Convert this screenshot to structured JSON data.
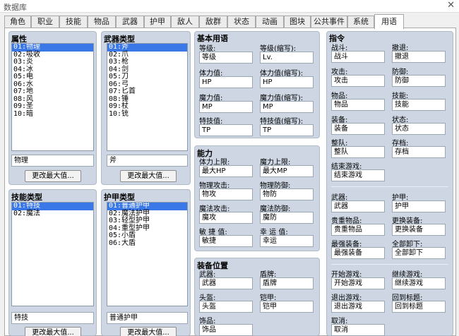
{
  "window": {
    "title": "数据库",
    "close": "✕"
  },
  "tabs": [
    "角色",
    "职业",
    "技能",
    "物品",
    "武器",
    "护甲",
    "敌人",
    "敌群",
    "状态",
    "动画",
    "图块",
    "公共事件",
    "系统",
    "用语"
  ],
  "attributes": {
    "title": "属性",
    "items": [
      "01:物理",
      "02:吸收",
      "03:炎",
      "04:冰",
      "05:电",
      "06:水",
      "07:地",
      "08:风",
      "09:圣",
      "10:暗"
    ],
    "value": "物理",
    "button": "更改最大值..."
  },
  "weapon_types": {
    "title": "武器类型",
    "items": [
      "01:斧",
      "02:爪",
      "03:枪",
      "04:剑",
      "05:刀",
      "06:弓",
      "07:匕首",
      "08:锤",
      "09:杖",
      "10:铳"
    ],
    "value": "斧",
    "button": "更改最大值..."
  },
  "skill_types": {
    "title": "技能类型",
    "items": [
      "01:特技",
      "02:魔法"
    ],
    "value": "特技",
    "button": "更改最大值..."
  },
  "armor_types": {
    "title": "护甲类型",
    "items": [
      "01:普通护甲",
      "02:魔法护甲",
      "03:轻型护甲",
      "04:重型护甲",
      "05:小盾",
      "06:大盾"
    ],
    "value": "普通护甲",
    "button": "更改最大值..."
  },
  "basic_terms": {
    "title": "基本用语",
    "fields": [
      {
        "label": "等级:",
        "value": "等级"
      },
      {
        "label": "等级(缩写):",
        "value": "Lv."
      },
      {
        "label": "体力值:",
        "value": "HP"
      },
      {
        "label": "体力值(缩写):",
        "value": "HP"
      },
      {
        "label": "魔力值:",
        "value": "MP"
      },
      {
        "label": "魔力值(缩写):",
        "value": "MP"
      },
      {
        "label": "特技值:",
        "value": "TP"
      },
      {
        "label": "特技值(缩写):",
        "value": "TP"
      }
    ]
  },
  "abilities": {
    "title": "能力",
    "fields": [
      {
        "label": "体力上限:",
        "value": "最大HP"
      },
      {
        "label": "魔力上限:",
        "value": "最大MP"
      },
      {
        "label": "物理攻击:",
        "value": "物攻"
      },
      {
        "label": "物理防御:",
        "value": "物防"
      },
      {
        "label": "魔法攻击:",
        "value": "魔攻"
      },
      {
        "label": "魔法防御:",
        "value": "魔防"
      },
      {
        "label": "敏 捷 值:",
        "value": "敏捷"
      },
      {
        "label": "幸 运 值:",
        "value": "幸运"
      }
    ]
  },
  "equip_slots": {
    "title": "装备位置",
    "fields": [
      {
        "label": "武器:",
        "value": "武器"
      },
      {
        "label": "盾牌:",
        "value": "盾牌"
      },
      {
        "label": "头盔:",
        "value": "头盔"
      },
      {
        "label": "铠甲:",
        "value": "铠甲"
      },
      {
        "label": "饰品:",
        "value": "饰品"
      }
    ]
  },
  "commands": {
    "title": "指令",
    "fields": [
      {
        "label": "战斗:",
        "value": "战斗"
      },
      {
        "label": "撤退:",
        "value": "撤退"
      },
      {
        "label": "攻击:",
        "value": "攻击"
      },
      {
        "label": "防御:",
        "value": "防御"
      },
      {
        "label": "物品:",
        "value": "物品"
      },
      {
        "label": "技能:",
        "value": "技能"
      },
      {
        "label": "装备:",
        "value": "装备"
      },
      {
        "label": "状态:",
        "value": "状态"
      },
      {
        "label": "整队:",
        "value": "整队"
      },
      {
        "label": "存档:",
        "value": "存档"
      },
      {
        "label": "结束游戏:",
        "value": "结束游戏"
      },
      {
        "label": "武器:",
        "value": "武器"
      },
      {
        "label": "护甲:",
        "value": "护甲"
      },
      {
        "label": "贵重物品:",
        "value": "贵重物品"
      },
      {
        "label": "更换装备:",
        "value": "更换装备"
      },
      {
        "label": "最强装备:",
        "value": "最强装备"
      },
      {
        "label": "全部卸下:",
        "value": "全部卸下"
      },
      {
        "label": "开始游戏:",
        "value": "开始游戏"
      },
      {
        "label": "继续游戏:",
        "value": "继续游戏"
      },
      {
        "label": "退出游戏:",
        "value": "退出游戏"
      },
      {
        "label": "回到标题:",
        "value": "回到标题"
      },
      {
        "label": "取消:",
        "value": "取消"
      }
    ]
  }
}
